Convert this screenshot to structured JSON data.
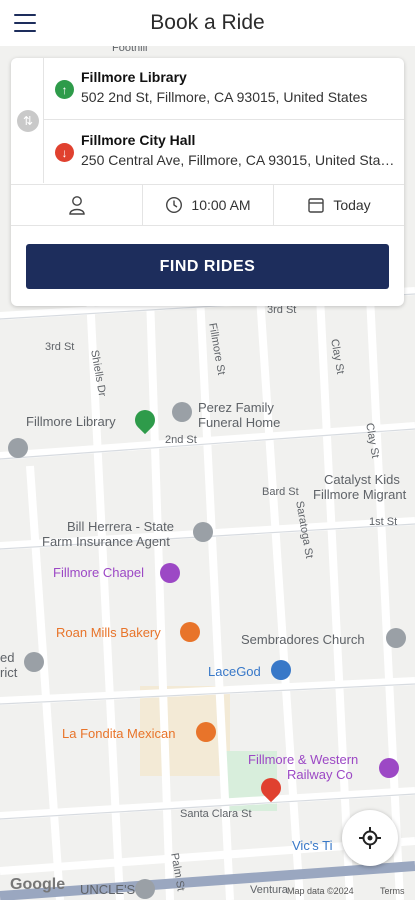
{
  "header": {
    "title": "Book a Ride",
    "menu_icon": "hamburger-menu-icon"
  },
  "route": {
    "from": {
      "name": "Fillmore Library",
      "address": "502 2nd St, Fillmore, CA 93015, United States",
      "color": "#2e9b4a"
    },
    "to": {
      "name": "Fillmore City Hall",
      "address": "250 Central Ave, Fillmore, CA 93015, United States",
      "color": "#e0412f"
    }
  },
  "options": {
    "time": "10:00 AM",
    "date": "Today"
  },
  "find_button": "FIND RIDES",
  "map": {
    "streets": [
      "Foothill",
      "3rd St",
      "3rd St",
      "Fillmore St",
      "Clay St",
      "Shiells Dr",
      "2nd St",
      "Clay St",
      "Bard St",
      "Saratoga St",
      "1st St",
      "Santa Clara St",
      "Palm St",
      "Ventura"
    ],
    "pois": [
      {
        "name": "Fillmore Library",
        "color": "#5f6368"
      },
      {
        "name": "Perez Family",
        "color": "#5f6368"
      },
      {
        "name": "Funeral Home",
        "color": "#5f6368"
      },
      {
        "name": "Catalyst Kids",
        "color": "#5f6368"
      },
      {
        "name": "Fillmore Migrant",
        "color": "#5f6368"
      },
      {
        "name": "Bill Herrera - State",
        "color": "#5f6368"
      },
      {
        "name": "Farm Insurance Agent",
        "color": "#5f6368"
      },
      {
        "name": "Fillmore Chapel",
        "color": "#9c48c5"
      },
      {
        "name": "Roan Mills Bakery",
        "color": "#e8742a"
      },
      {
        "name": "Sembradores Church",
        "color": "#5f6368"
      },
      {
        "name": "ed",
        "color": "#5f6368"
      },
      {
        "name": "rict",
        "color": "#5f6368"
      },
      {
        "name": "LaceGod",
        "color": "#3878c8"
      },
      {
        "name": "La Fondita Mexican",
        "color": "#e8742a"
      },
      {
        "name": "Fillmore & Western",
        "color": "#9c48c5"
      },
      {
        "name": "Railway Co",
        "color": "#9c48c5"
      },
      {
        "name": "Vic's Ti",
        "color": "#3878c8"
      },
      {
        "name": "UNCLE'S",
        "color": "#5f6368"
      }
    ],
    "google": "Google",
    "attribution": "Map data ©2024",
    "terms": "Terms"
  }
}
